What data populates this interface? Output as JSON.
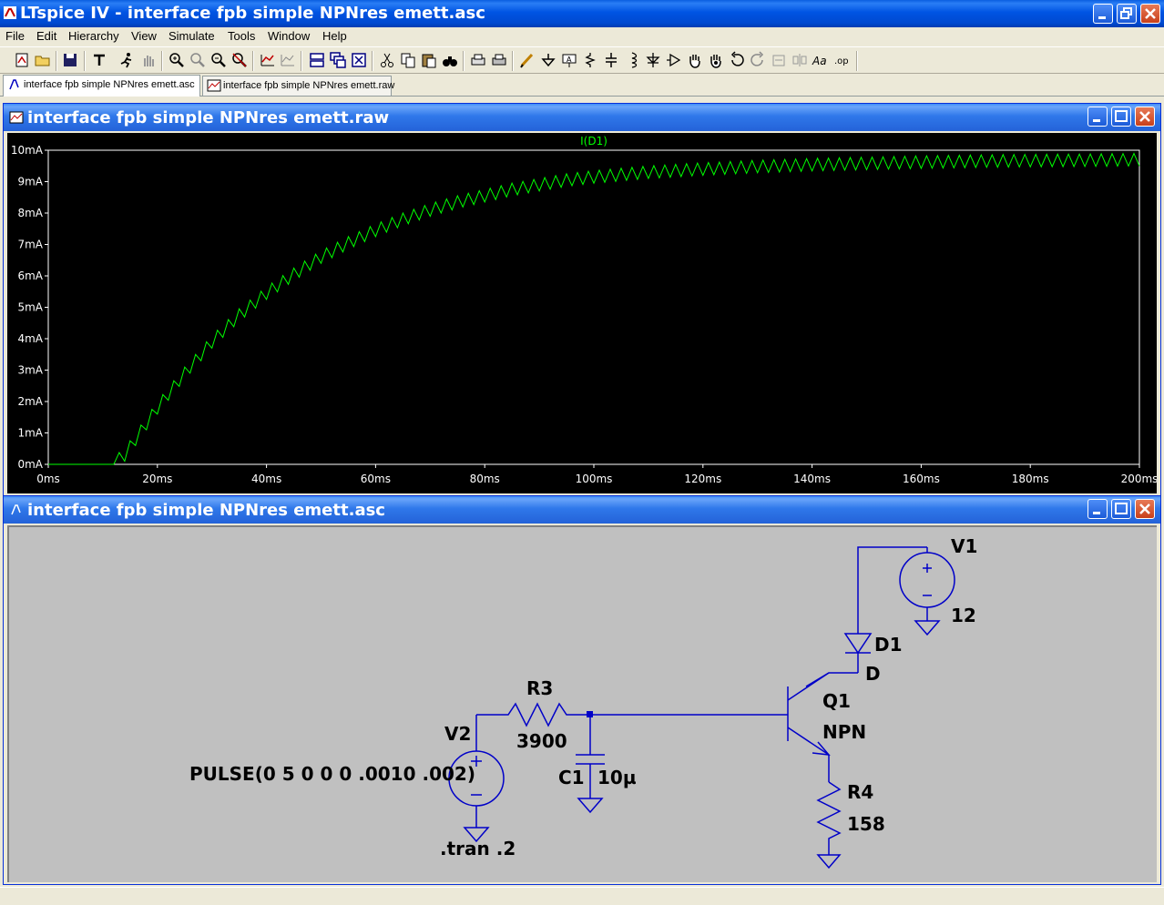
{
  "window": {
    "title": "LTspice IV - interface fpb simple NPNres emett.asc"
  },
  "menu": {
    "items": [
      {
        "label": "File"
      },
      {
        "label": "Edit"
      },
      {
        "label": "Hierarchy"
      },
      {
        "label": "View"
      },
      {
        "label": "Simulate"
      },
      {
        "label": "Tools"
      },
      {
        "label": "Window"
      },
      {
        "label": "Help"
      }
    ]
  },
  "tabs": [
    {
      "label": "interface fpb simple NPNres emett.asc",
      "active": true
    },
    {
      "label": "interface fpb simple NPNres emett.raw",
      "active": false
    }
  ],
  "waveform_window": {
    "title": "interface fpb simple NPNres emett.raw"
  },
  "schematic_window": {
    "title": "interface fpb simple NPNres emett.asc"
  },
  "schematic": {
    "V1": {
      "name": "V1",
      "value": "12"
    },
    "D1": {
      "name": "D1",
      "value": "D"
    },
    "Q1": {
      "name": "Q1",
      "value": "NPN"
    },
    "R3": {
      "name": "R3",
      "value": "3900"
    },
    "R4": {
      "name": "R4",
      "value": "158"
    },
    "V2": {
      "name": "V2",
      "value": "PULSE(0 5 0 0 0 .0010 .002)"
    },
    "C1": {
      "name": "C1",
      "value": "10µ"
    },
    "directive": ".tran .2"
  },
  "colors": {
    "trace": "#00ff00",
    "plot_bg": "#000000",
    "schematic_bg": "#c0c0c0",
    "wire": "#0000c8",
    "title_blue": "#0054e3"
  },
  "chart_data": {
    "type": "line",
    "title": "I(D1)",
    "xlabel": "",
    "ylabel": "",
    "xlim": [
      0,
      200
    ],
    "ylim": [
      0,
      10
    ],
    "x_ticks": [
      "0ms",
      "20ms",
      "40ms",
      "60ms",
      "80ms",
      "100ms",
      "120ms",
      "140ms",
      "160ms",
      "180ms",
      "200ms"
    ],
    "y_ticks": [
      "0mA",
      "1mA",
      "2mA",
      "3mA",
      "4mA",
      "5mA",
      "6mA",
      "7mA",
      "8mA",
      "9mA",
      "10mA"
    ],
    "grid": false,
    "series": [
      {
        "name": "I(D1)",
        "x_unit": "ms",
        "y_unit": "mA",
        "x": [
          0,
          10,
          11,
          12,
          14,
          16,
          20,
          25,
          30,
          35,
          40,
          45,
          50,
          55,
          60,
          65,
          70,
          75,
          80,
          85,
          90,
          95,
          100,
          110,
          120,
          130,
          140,
          150,
          160,
          170,
          180,
          190,
          200
        ],
        "y": [
          0,
          0,
          0,
          0.05,
          0.3,
          0.8,
          1.8,
          2.9,
          3.9,
          4.75,
          5.45,
          6.05,
          6.6,
          7.05,
          7.45,
          7.8,
          8.1,
          8.35,
          8.55,
          8.75,
          8.9,
          9.05,
          9.15,
          9.3,
          9.4,
          9.48,
          9.54,
          9.58,
          9.62,
          9.65,
          9.67,
          9.68,
          9.7
        ],
        "ripple_period": 2,
        "ripple_amplitude": 0.4
      }
    ]
  }
}
